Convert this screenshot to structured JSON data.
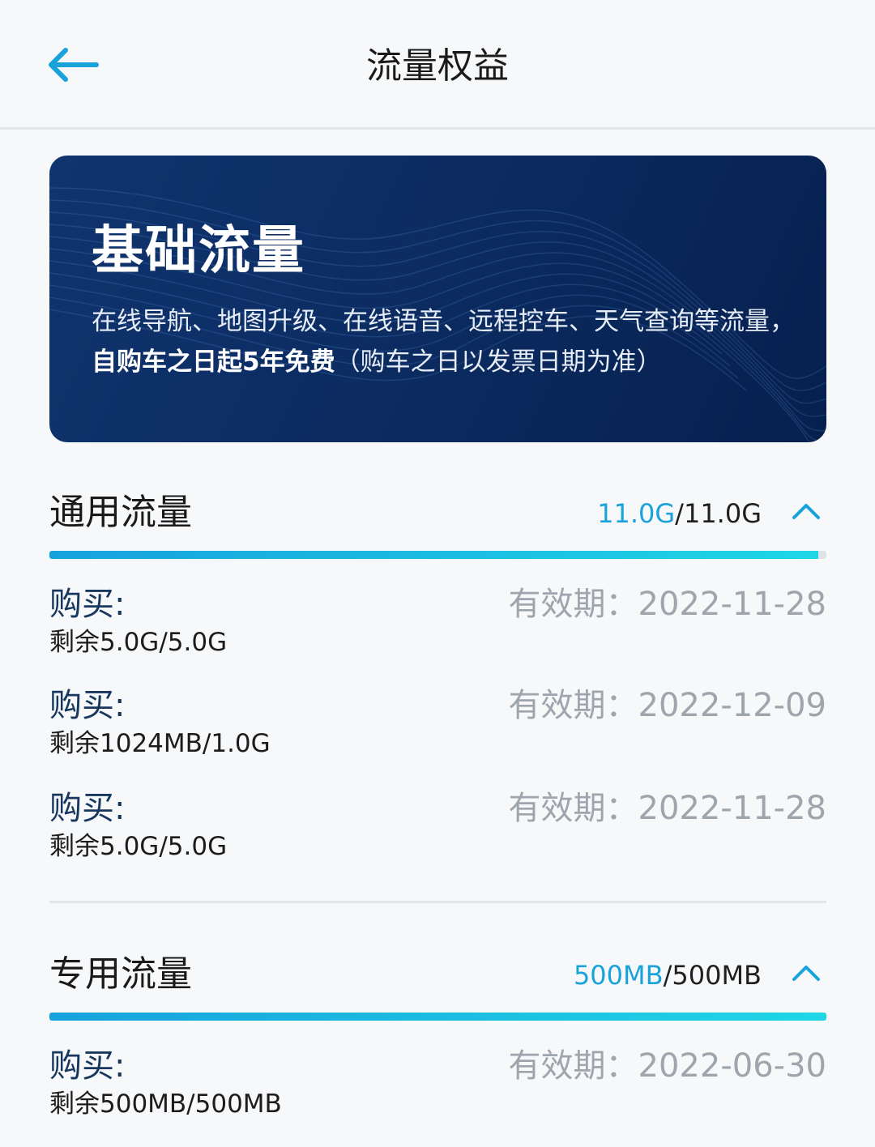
{
  "header": {
    "title": "流量权益"
  },
  "banner": {
    "title": "基础流量",
    "desc_part1": "在线导航、地图升级、在线语音、远程控车、天气查询等流量，",
    "desc_highlight": "自购车之日起5年免费",
    "desc_part2": "（购车之日以发票日期为准）"
  },
  "sections": [
    {
      "title": "通用流量",
      "used": "11.0G",
      "total": "/11.0G",
      "progress_fraction": 0.99,
      "items": [
        {
          "label": "购买:",
          "remain": "剩余5.0G/5.0G",
          "expiry": "有效期：2022-11-28"
        },
        {
          "label": "购买:",
          "remain": "剩余1024MB/1.0G",
          "expiry": "有效期：2022-12-09"
        },
        {
          "label": "购买:",
          "remain": "剩余5.0G/5.0G",
          "expiry": "有效期：2022-11-28"
        }
      ]
    },
    {
      "title": "专用流量",
      "used": "500MB",
      "total": "/500MB",
      "progress_fraction": 1.0,
      "items": [
        {
          "label": "购买:",
          "remain": "剩余500MB/500MB",
          "expiry": "有效期：2022-06-30"
        }
      ]
    }
  ],
  "colors": {
    "accent": "#1aa3db",
    "banner_bg": "#0c2c62",
    "label": "#17375e",
    "muted": "#9ea5ad"
  },
  "icons": {
    "back": "arrow-left-icon",
    "collapse": "chevron-up-icon"
  }
}
